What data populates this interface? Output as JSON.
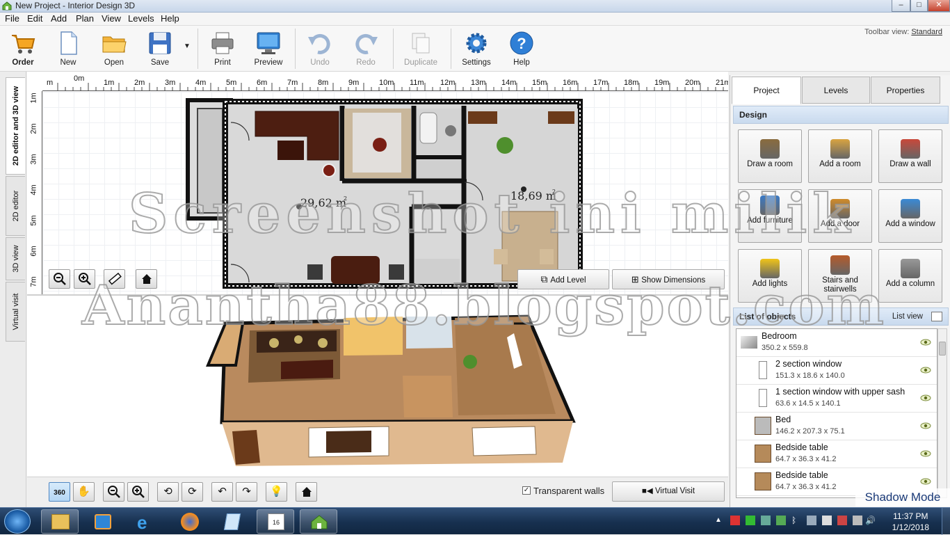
{
  "window": {
    "title": "New Project - Interior Design 3D",
    "controls": [
      "–",
      "□",
      "✕"
    ]
  },
  "menu": [
    "File",
    "Edit",
    "Add",
    "Plan",
    "View",
    "Levels",
    "Help"
  ],
  "toolbar": {
    "items": [
      {
        "label": "Order",
        "icon": "cart-icon"
      },
      {
        "label": "New",
        "icon": "new-file-icon"
      },
      {
        "label": "Open",
        "icon": "folder-icon"
      },
      {
        "label": "Save",
        "icon": "floppy-icon"
      },
      {
        "label": "Print",
        "icon": "printer-icon"
      },
      {
        "label": "Preview",
        "icon": "monitor-icon"
      },
      {
        "label": "Undo",
        "icon": "undo-icon"
      },
      {
        "label": "Redo",
        "icon": "redo-icon"
      },
      {
        "label": "Duplicate",
        "icon": "duplicate-icon"
      },
      {
        "label": "Settings",
        "icon": "gear-icon"
      },
      {
        "label": "Help",
        "icon": "help-icon"
      }
    ],
    "view_label": "Toolbar view:",
    "view_value": "Standard"
  },
  "left_tabs": [
    "2D editor and 3D view",
    "2D editor",
    "3D view",
    "Virtual visit"
  ],
  "ruler": {
    "h_labels": [
      "m",
      "0m",
      "1m",
      "2m",
      "3m",
      "4m",
      "5m",
      "6m",
      "7m",
      "8m",
      "9m",
      "10m",
      "11m",
      "12m",
      "13m",
      "14m",
      "15m",
      "16m",
      "17m",
      "18m",
      "19m",
      "20m",
      "21m"
    ],
    "v_labels": [
      "1m",
      "2m",
      "3m",
      "4m",
      "5m",
      "6m",
      "7m"
    ]
  },
  "plan": {
    "area1": "29,62 m",
    "area2": "18,69 m",
    "sup": "2"
  },
  "editor_buttons": {
    "add_level": "Add Level",
    "show_dimensions": "Show Dimensions"
  },
  "bottom": {
    "transparent_walls": "Transparent walls",
    "virtual_visit": "Virtual Visit"
  },
  "right_panel": {
    "tabs": [
      "Project",
      "Levels",
      "Properties"
    ],
    "design_header": "Design",
    "design_buttons": [
      {
        "label": "Draw a room",
        "icon": "draw-room-icon"
      },
      {
        "label": "Add a room",
        "icon": "add-room-icon"
      },
      {
        "label": "Draw a wall",
        "icon": "brick-wall-icon"
      },
      {
        "label": "Add furniture",
        "icon": "furniture-icon"
      },
      {
        "label": "Add a door",
        "icon": "door-icon"
      },
      {
        "label": "Add a window",
        "icon": "window-icon"
      },
      {
        "label": "Add lights",
        "icon": "bulb-icon"
      },
      {
        "label": "Stairs and stairwells",
        "icon": "stairs-icon"
      },
      {
        "label": "Add a column",
        "icon": "column-icon"
      }
    ],
    "list_header": "List of objects",
    "list_view": "List view",
    "objects": [
      {
        "name": "Bedroom",
        "dims": "350.2 x 559.8"
      },
      {
        "name": "2 section window",
        "dims": "151.3 x 18.6 x 140.0"
      },
      {
        "name": "1 section window with upper sash",
        "dims": "63.6 x 14.5 x 140.1"
      },
      {
        "name": "Bed",
        "dims": "146.2 x 207.3 x 75.1"
      },
      {
        "name": "Bedside table",
        "dims": "64.7 x 36.3 x 41.2"
      },
      {
        "name": "Bedside table",
        "dims": "64.7 x 36.3 x 41.2"
      }
    ]
  },
  "shadow_mode": "Shadow Mode",
  "watermark": {
    "line1": "Screenshot ini milik",
    "line2": "Anantha88.blogspot.com"
  },
  "taskbar": {
    "time": "11:37 PM",
    "date": "1/12/2018"
  }
}
